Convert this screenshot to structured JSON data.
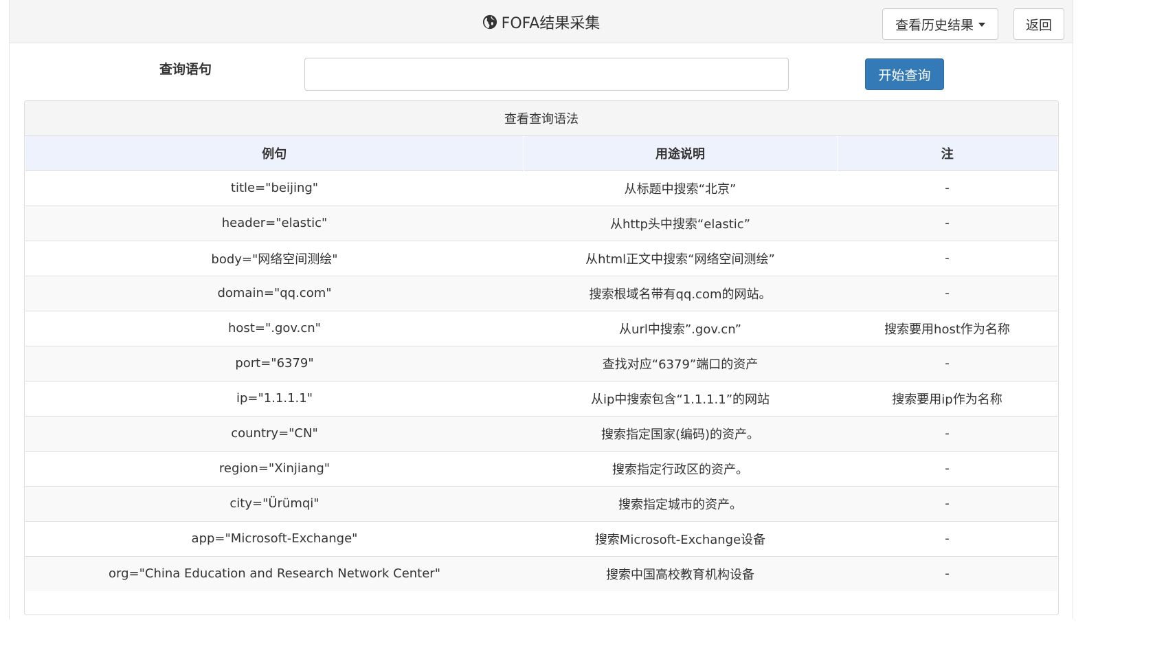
{
  "header": {
    "title": "FOFA结果采集",
    "title_icon": "globe-icon",
    "history_button": "查看历史结果",
    "back_button": "返回"
  },
  "query": {
    "label": "查询语句",
    "input_value": "",
    "input_placeholder": "",
    "start_button": "开始查询"
  },
  "syntax_panel": {
    "heading": "查看查询语法",
    "columns": [
      "例句",
      "用途说明",
      "注"
    ],
    "rows": [
      [
        "title=\"beijing\"",
        "从标题中搜索“北京”",
        "-"
      ],
      [
        "header=\"elastic\"",
        "从http头中搜索“elastic”",
        "-"
      ],
      [
        "body=\"网络空间测绘\"",
        "从html正文中搜索“网络空间测绘”",
        "-"
      ],
      [
        "domain=\"qq.com\"",
        "搜索根域名带有qq.com的网站。",
        "-"
      ],
      [
        "host=\".gov.cn\"",
        "从url中搜索”.gov.cn”",
        "搜索要用host作为名称"
      ],
      [
        "port=\"6379\"",
        "查找对应“6379”端口的资产",
        "-"
      ],
      [
        "ip=\"1.1.1.1\"",
        "从ip中搜索包含“1.1.1.1”的网站",
        "搜索要用ip作为名称"
      ],
      [
        "country=\"CN\"",
        "搜索指定国家(编码)的资产。",
        "-"
      ],
      [
        "region=\"Xinjiang\"",
        "搜索指定行政区的资产。",
        "-"
      ],
      [
        "city=\"Ürümqi\"",
        "搜索指定城市的资产。",
        "-"
      ],
      [
        "app=\"Microsoft-Exchange\"",
        "搜索Microsoft-Exchange设备",
        "-"
      ],
      [
        "org=\"China Education and Research Network Center\"",
        "搜索中国高校教育机构设备",
        "-"
      ]
    ]
  },
  "colors": {
    "primary": "#337ab7",
    "header_bg": "#f5f5f5",
    "table_head_bg": "#eef2fc"
  }
}
